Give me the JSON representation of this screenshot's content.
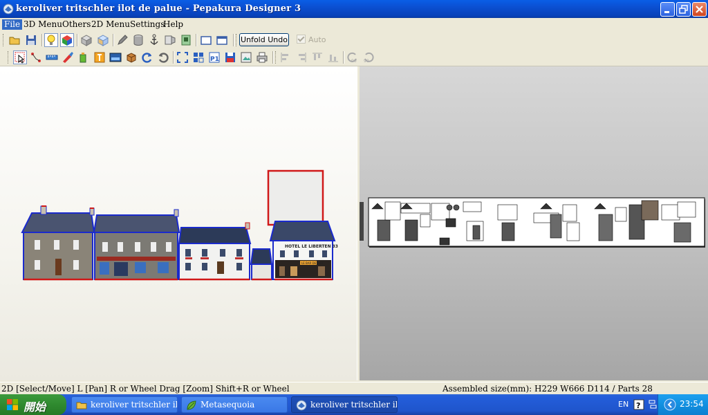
{
  "window": {
    "title": "keroliver tritschler ilot de palue - Pepakura Designer 3"
  },
  "menu": {
    "items": [
      "File",
      "3D Menu",
      "Others",
      "2D Menu",
      "Settings",
      "Help"
    ]
  },
  "toolbar": {
    "unfold_undo_label": "Unfold Undo",
    "auto_label": "Auto",
    "auto_checked": true
  },
  "status": {
    "left": "2D [Select/Move] L [Pan] R or Wheel Drag [Zoom] Shift+R or Wheel",
    "right": "Assembled size(mm): H229 W666 D114 / Parts 28"
  },
  "taskbar": {
    "start_label": "開始",
    "tasks": [
      {
        "label": "keroliver tritschler ilot ...",
        "icon": "folder-icon"
      },
      {
        "label": "Metasequoia",
        "icon": "leaf-icon"
      },
      {
        "label": "keroliver tritschler ilot ...",
        "icon": "pepakura-icon"
      }
    ],
    "language": "EN",
    "clock": "23:54"
  },
  "model": {
    "hotel_sign": "HOTEL LE LIBERTEN 33",
    "shop_sign": "LE BAR DE NUIT"
  }
}
